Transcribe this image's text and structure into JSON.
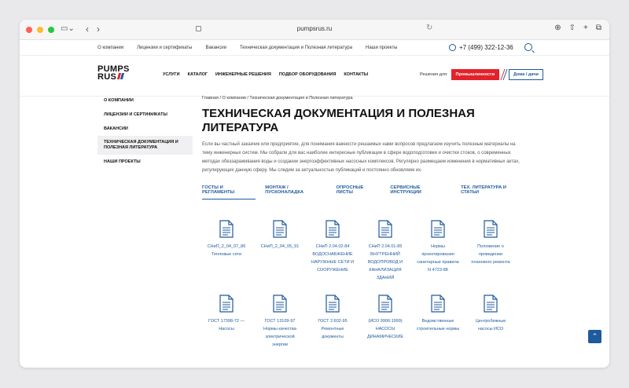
{
  "browser": {
    "url": "pumpsrus.ru"
  },
  "topbar": {
    "links": [
      "О компании",
      "Лицензии и сертификаты",
      "Вакансии",
      "Техническая документация и Полезная литература",
      "Наши проекты"
    ],
    "phone": "+7 (499) 322-12-36"
  },
  "header": {
    "logo_line1": "PUMPS",
    "logo_line2": "RUS",
    "nav": [
      "УСЛУГИ",
      "КАТАЛОГ",
      "ИНЖЕНЕРНЫЕ РЕШЕНИЯ",
      "ПОДБОР ОБОРУДОВАНИЯ",
      "КОНТАКТЫ"
    ],
    "solutions_label": "Решения для:",
    "industry_button": "Промышленности",
    "home_button": "Дома / дачи"
  },
  "sidebar": {
    "items": [
      "О КОМПАНИИ",
      "ЛИЦЕНЗИИ И СЕРТИФИКАТЫ",
      "ВАКАНСИИ",
      "ТЕХНИЧЕСКАЯ ДОКУМЕНТАЦИЯ И ПОЛЕЗНАЯ ЛИТЕРАТУРА",
      "НАШИ ПРОЕКТЫ"
    ]
  },
  "main": {
    "breadcrumb": "Главная / О компании / Техническая документация и Полезная литература",
    "title": "ТЕХНИЧЕСКАЯ ДОКУМЕНТАЦИЯ И ПОЛЕЗНАЯ ЛИТЕРАТУРА",
    "intro": "Если вы частный заказчик или предприятие, для понимания важности решаемых нами вопросов предлагаем изучить полезные материалы на тему инженерных систем. Мы собрали для вас наиболее интересные публикации в сфере водоподготовки и очистки стоков, о современных методах обеззараживания воды и создании энергоэффективных насосных комплексов. Регулярно размещаем изменения в нормативных актах, регулирующих данную сферу. Мы следим за актуальностью публикаций и постоянно обновляем их.",
    "tabs": [
      "ГОСТЫ И РЕГЛАМЕНТЫ",
      "МОНТАЖ / ПУСКОНАЛАДКА",
      "ОПРОСНЫЕ ЛИСТЫ",
      "СЕРВИСНЫЕ ИНСТРУКЦИИ",
      "ТЕХ. ЛИТЕРАТУРА И СТАТЬИ"
    ]
  },
  "documents": [
    {
      "line1": "СНиП_2_04_07_86",
      "line2": "Тепловые сети"
    },
    {
      "line1": "СНиП_2_04_05_91",
      "line2": ""
    },
    {
      "line1": "СНиП 2.04.02-84",
      "line2": "ВОДОСНАБЖЕНИЕ НАРУЖНЫЕ СЕТИ И СООРУЖЕНИЕ"
    },
    {
      "line1": "СНиП 2.04.01-85",
      "line2": "ВНУТРЕННИЙ ВОДОПРОВОД И КАНАЛИЗАЦИЯ ЗДАНИЙ"
    },
    {
      "line1": "Нормы",
      "line2": "проектирования санитарные правила N 4723-88"
    },
    {
      "line1": "Положение о",
      "line2": "проведении планового ремонта"
    },
    {
      "line1": "ГОСТ 17398-72 —",
      "line2": "Насосы"
    },
    {
      "line1": "ГОСТ 13109-97",
      "line2": "Нормы качества электрической энергии"
    },
    {
      "line1": "ГОСТ 2.602-95",
      "line2": "Ремонтные документы"
    },
    {
      "line1": "(ИСО 9906:1999)",
      "line2": "НАСОСЫ ДИНАМИЧЕСКИЕ"
    },
    {
      "line1": "Ведомственные",
      "line2": "строительные нормы"
    },
    {
      "line1": "Центробежные",
      "line2": "насосы ИСО"
    }
  ],
  "colors": {
    "accent": "#1f5a9c",
    "red": "#e3212a"
  }
}
